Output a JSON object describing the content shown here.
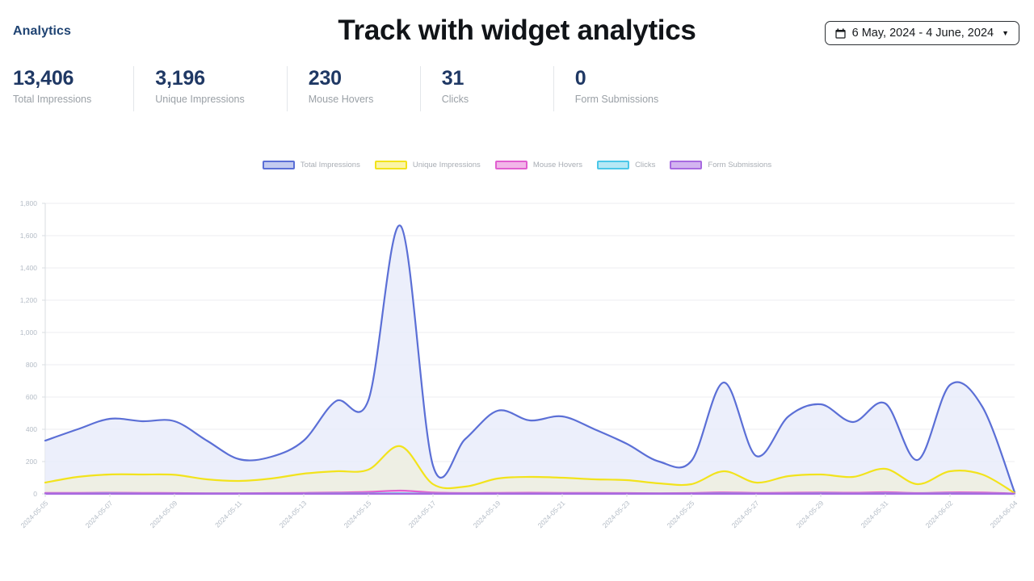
{
  "header": {
    "brand": "Analytics",
    "title": "Track with widget analytics",
    "daterange": {
      "label": "6 May, 2024 - 4 June, 2024",
      "calendar_icon": "calendar-icon",
      "caret_icon": "chevron-down-icon"
    }
  },
  "stats": [
    {
      "value": "13,406",
      "label": "Total Impressions"
    },
    {
      "value": "3,196",
      "label": "Unique Impressions"
    },
    {
      "value": "230",
      "label": "Mouse Hovers"
    },
    {
      "value": "31",
      "label": "Clicks"
    },
    {
      "value": "0",
      "label": "Form Submissions"
    }
  ],
  "chart_data": {
    "type": "area",
    "title": "",
    "xlabel": "",
    "ylabel": "",
    "grid": true,
    "legend_position": "top-center",
    "ylim": [
      0,
      1800
    ],
    "yticks": [
      0,
      200,
      400,
      600,
      800,
      1000,
      1200,
      1400,
      1600,
      1800
    ],
    "ytick_labels": [
      "0",
      "200",
      "400",
      "600",
      "800",
      "1,000",
      "1,200",
      "1,400",
      "1,600",
      "1,800"
    ],
    "x": [
      "2024-05-05",
      "2024-05-06",
      "2024-05-07",
      "2024-05-08",
      "2024-05-09",
      "2024-05-10",
      "2024-05-11",
      "2024-05-12",
      "2024-05-13",
      "2024-05-14",
      "2024-05-15",
      "2024-05-16",
      "2024-05-17",
      "2024-05-18",
      "2024-05-19",
      "2024-05-20",
      "2024-05-21",
      "2024-05-22",
      "2024-05-23",
      "2024-05-24",
      "2024-05-25",
      "2024-05-26",
      "2024-05-27",
      "2024-05-28",
      "2024-05-29",
      "2024-05-30",
      "2024-05-31",
      "2024-06-01",
      "2024-06-02",
      "2024-06-03",
      "2024-06-04"
    ],
    "xtick_labels": [
      "2024-05-05",
      "2024-05-07",
      "2024-05-09",
      "2024-05-11",
      "2024-05-13",
      "2024-05-15",
      "2024-05-17",
      "2024-05-19",
      "2024-05-21",
      "2024-05-23",
      "2024-05-25",
      "2024-05-27",
      "2024-05-29",
      "2024-05-31",
      "2024-06-02",
      "2024-06-04"
    ],
    "xtick_every": 2,
    "series": [
      {
        "name": "Total Impressions",
        "stroke": "#5b6fd6",
        "fill": "#e9ecfa",
        "swatch_fill": "#c3cbf0",
        "values": [
          330,
          400,
          465,
          450,
          450,
          330,
          215,
          230,
          330,
          575,
          580,
          1660,
          175,
          340,
          515,
          455,
          480,
          400,
          310,
          200,
          205,
          690,
          235,
          480,
          555,
          445,
          560,
          210,
          675,
          540,
          10
        ]
      },
      {
        "name": "Unique Impressions",
        "stroke": "#f2e31c",
        "fill": "#efefdf",
        "swatch_fill": "#fbf4a8",
        "values": [
          70,
          105,
          120,
          120,
          118,
          90,
          80,
          95,
          125,
          140,
          150,
          295,
          60,
          45,
          95,
          105,
          100,
          90,
          85,
          65,
          60,
          140,
          70,
          110,
          120,
          105,
          155,
          60,
          140,
          120,
          5
        ]
      },
      {
        "name": "Mouse Hovers",
        "stroke": "#e15fd0",
        "fill": "#f7d9f2",
        "swatch_fill": "#f2b6e8",
        "values": [
          6,
          6,
          7,
          6,
          5,
          4,
          4,
          5,
          6,
          8,
          12,
          20,
          8,
          5,
          6,
          7,
          6,
          6,
          5,
          4,
          5,
          9,
          6,
          7,
          8,
          7,
          10,
          5,
          9,
          8,
          2
        ]
      },
      {
        "name": "Clicks",
        "stroke": "#4cc7e8",
        "fill": "#d6f2fa",
        "swatch_fill": "#b6e8f5",
        "values": [
          1,
          1,
          2,
          1,
          1,
          1,
          1,
          1,
          1,
          2,
          2,
          3,
          1,
          1,
          1,
          1,
          1,
          1,
          1,
          1,
          1,
          2,
          1,
          1,
          2,
          1,
          2,
          1,
          2,
          1,
          0
        ]
      },
      {
        "name": "Form Submissions",
        "stroke": "#a86ae0",
        "fill": "#ecdcfa",
        "swatch_fill": "#d3b4f0",
        "values": [
          0,
          0,
          0,
          0,
          0,
          0,
          0,
          0,
          0,
          0,
          0,
          0,
          0,
          0,
          0,
          0,
          0,
          0,
          0,
          0,
          0,
          0,
          0,
          0,
          0,
          0,
          0,
          0,
          0,
          0,
          0
        ]
      }
    ]
  }
}
